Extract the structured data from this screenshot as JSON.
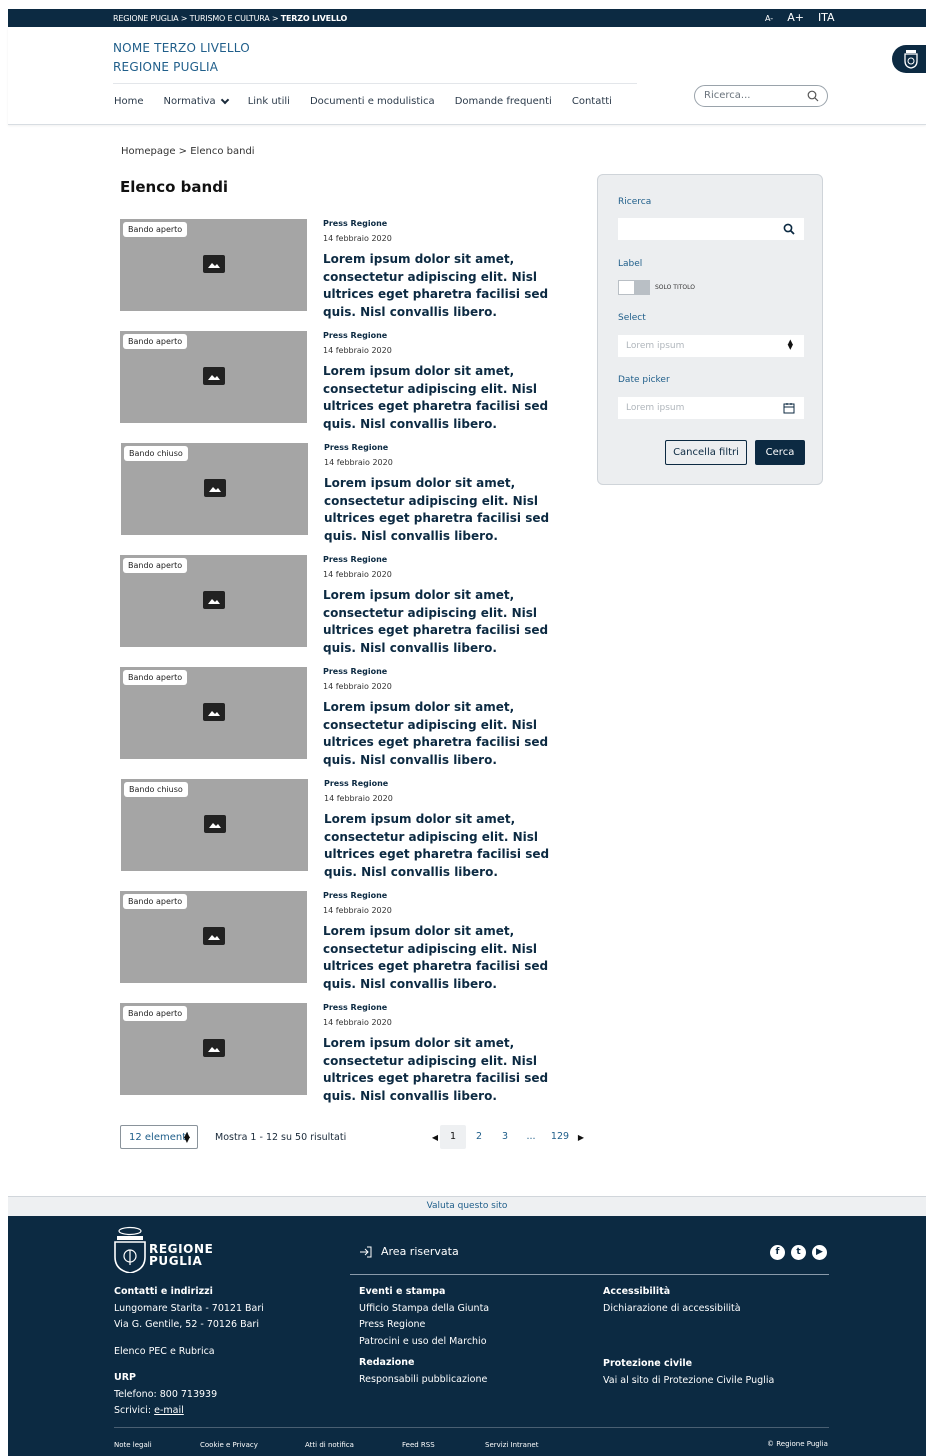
{
  "topbar": {
    "crumb_prefix": "REGIONE PUGLIA > TURISMO E CULTURA >",
    "crumb_current": "TERZO LIVELLO",
    "font_small": "A-",
    "font_large": "A+",
    "language": "ITA"
  },
  "header": {
    "site_name_line1": "NOME TERZO LIVELLO",
    "site_name_line2": "REGIONE PUGLIA",
    "nav": [
      {
        "label": "Home"
      },
      {
        "label": "Normativa"
      },
      {
        "label": "Link utili"
      },
      {
        "label": "Documenti e modulistica"
      },
      {
        "label": "Domande frequenti"
      },
      {
        "label": "Contatti"
      }
    ],
    "search_placeholder": "Ricerca..."
  },
  "breadcrumb": "Homepage  >  Elenco bandi",
  "page_title": "Elenco bandi",
  "cards": [
    {
      "badge": "Bando aperto",
      "source": "Press Regione",
      "date": "14 febbraio 2020",
      "title": "Lorem ipsum dolor sit amet, consectetur adipiscing elit. Nisl ultrices eget pharetra facilisi sed quis. Nisl convallis libero."
    },
    {
      "badge": "Bando aperto",
      "source": "Press Regione",
      "date": "14 febbraio 2020",
      "title": "Lorem ipsum dolor sit amet, consectetur adipiscing elit. Nisl ultrices eget pharetra facilisi sed quis. Nisl convallis libero."
    },
    {
      "badge": "Bando chiuso",
      "source": "Press Regione",
      "date": "14 febbraio 2020",
      "title": "Lorem ipsum dolor sit amet, consectetur adipiscing elit. Nisl ultrices eget pharetra facilisi sed quis. Nisl convallis libero."
    },
    {
      "badge": "Bando aperto",
      "source": "Press Regione",
      "date": "14 febbraio 2020",
      "title": "Lorem ipsum dolor sit amet, consectetur adipiscing elit. Nisl ultrices eget pharetra facilisi sed quis. Nisl convallis libero."
    },
    {
      "badge": "Bando aperto",
      "source": "Press Regione",
      "date": "14 febbraio 2020",
      "title": "Lorem ipsum dolor sit amet, consectetur adipiscing elit. Nisl ultrices eget pharetra facilisi sed quis. Nisl convallis libero."
    },
    {
      "badge": "Bando chiuso",
      "source": "Press Regione",
      "date": "14 febbraio 2020",
      "title": "Lorem ipsum dolor sit amet, consectetur adipiscing elit. Nisl ultrices eget pharetra facilisi sed quis. Nisl convallis libero."
    },
    {
      "badge": "Bando aperto",
      "source": "Press Regione",
      "date": "14 febbraio 2020",
      "title": "Lorem ipsum dolor sit amet, consectetur adipiscing elit. Nisl ultrices eget pharetra facilisi sed quis. Nisl convallis libero."
    },
    {
      "badge": "Bando aperto",
      "source": "Press Regione",
      "date": "14 febbraio 2020",
      "title": "Lorem ipsum dolor sit amet, consectetur adipiscing elit. Nisl ultrices eget pharetra facilisi sed quis. Nisl convallis libero."
    }
  ],
  "filter": {
    "search_label": "Ricerca",
    "search_value": "",
    "toggle_label": "Label",
    "toggle_text": "SOLO TITOLO",
    "select_label": "Select",
    "select_placeholder": "Lorem ipsum",
    "date_label": "Date picker",
    "date_placeholder": "Lorem ipsum",
    "clear_button": "Cancella filtri",
    "submit_button": "Cerca"
  },
  "pagination": {
    "per_page": "12 elementi",
    "results_text": "Mostra 1 - 12 su 50 risultati",
    "pages": [
      "1",
      "2",
      "3",
      "...",
      "129"
    ],
    "current_page": "1"
  },
  "footer": {
    "rate_site": "Valuta questo sito",
    "logo_line1": "REGIONE",
    "logo_line2": "PUGLIA",
    "reserved_area": "Area riservata",
    "contacts": {
      "heading": "Contatti e indirizzi",
      "line1": "Lungomare Starita - 70121 Bari",
      "line2": "Via G. Gentile, 52 - 70126 Bari",
      "pec": "Elenco PEC e Rubrica",
      "urp_heading": "URP",
      "phone": "Telefono: 800 713939",
      "write_prefix": "Scrivici: ",
      "write_link": "e-mail"
    },
    "events": {
      "heading": "Eventi e stampa",
      "items": [
        "Ufficio Stampa della Giunta",
        "Press Regione",
        "Patrocini e uso del Marchio"
      ],
      "redazione_heading": "Redazione",
      "redazione_item": "Responsabili pubblicazione"
    },
    "accessibility": {
      "heading": "Accessibilità",
      "item": "Dichiarazione di accessibilità",
      "civil_heading": "Protezione civile",
      "civil_item": "Vai al sito di Protezione Civile Puglia"
    },
    "legal": [
      "Note legali",
      "Cookie e Privacy",
      "Atti di notifica",
      "Feed RSS",
      "Servizi Intranet"
    ],
    "copyright": "© Regione Puglia"
  },
  "colors": {
    "brand_dark": "#0c2a42",
    "link_blue": "#1f5e8a",
    "thumb_gray": "#a5a5a5"
  }
}
